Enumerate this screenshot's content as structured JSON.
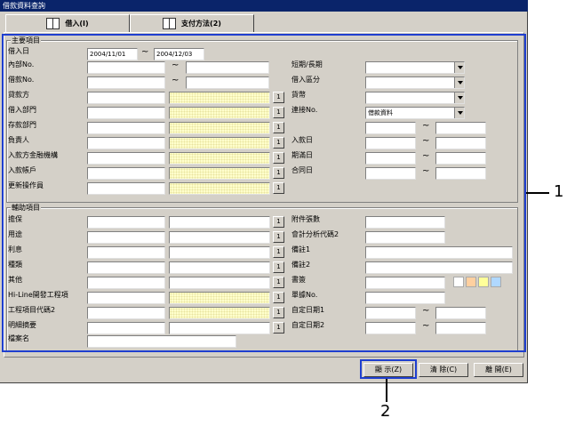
{
  "window": {
    "title": "借款資料查詢"
  },
  "tabs": [
    {
      "label": "借入(I)"
    },
    {
      "label": "支付方法(2)"
    }
  ],
  "main_group": {
    "legend": "主要項目",
    "borrow_date": {
      "label": "借入日",
      "from": "2004/11/01",
      "to": "2004/12/03"
    },
    "left_rows": [
      {
        "label": "內部No.",
        "value": ""
      },
      {
        "label": "借款No.",
        "value": ""
      },
      {
        "label": "貸款方",
        "value": ""
      },
      {
        "label": "借入部門",
        "value": ""
      },
      {
        "label": "存款部門",
        "value": ""
      },
      {
        "label": "負責人",
        "value": ""
      },
      {
        "label": "入款方金融機構",
        "value": ""
      },
      {
        "label": "入款帳戶",
        "value": ""
      },
      {
        "label": "更新操作員",
        "value": ""
      }
    ],
    "right_selects": [
      {
        "label": "短期/長期",
        "value": ""
      },
      {
        "label": "借入區分",
        "value": ""
      },
      {
        "label": "貨幣",
        "value": ""
      },
      {
        "label": "連接No.",
        "value": "借款資料"
      }
    ],
    "right_ranges": [
      {
        "label": "",
        "from": "",
        "to": ""
      },
      {
        "label": "入款日",
        "from": "",
        "to": ""
      },
      {
        "label": "期滿日",
        "from": "",
        "to": ""
      },
      {
        "label": "合同日",
        "from": "",
        "to": ""
      }
    ]
  },
  "aux_group": {
    "legend": "輔助項目",
    "left_rows": [
      {
        "label": "擔保",
        "value": ""
      },
      {
        "label": "用途",
        "value": ""
      },
      {
        "label": "利息",
        "value": ""
      },
      {
        "label": "種類",
        "value": ""
      },
      {
        "label": "其他",
        "value": ""
      },
      {
        "label": "Hi-Line開發工程項",
        "value": ""
      },
      {
        "label": "工程項目代碼2",
        "value": ""
      },
      {
        "label": "明細摘要",
        "value": ""
      }
    ],
    "file_name": {
      "label": "檔案名",
      "value": ""
    },
    "right_fields": [
      {
        "label": "附件張數",
        "value": ""
      },
      {
        "label": "會計分析代碼2",
        "value": ""
      },
      {
        "label": "備註1",
        "value": ""
      },
      {
        "label": "備註2",
        "value": ""
      },
      {
        "label": "書簽",
        "value": ""
      },
      {
        "label": "單據No.",
        "value": ""
      }
    ],
    "right_ranges": [
      {
        "label": "自定日期1",
        "from": "",
        "to": ""
      },
      {
        "label": "自定日期2",
        "from": "",
        "to": ""
      }
    ]
  },
  "range_sep": "~",
  "lookup_label": "1",
  "bookmark_colors": [
    "#ffffff",
    "#ffd0a0",
    "#ffff99",
    "#b0d8ff"
  ],
  "buttons": {
    "display": "顯 示(Z)",
    "clear": "清 除(C)",
    "close": "離 開(E)"
  },
  "callouts": {
    "one": "1",
    "two": "2"
  },
  "colors": {
    "callout": "#1f3fcf",
    "titlebar": "#0a246a",
    "highlight_input": "#ffffcc"
  }
}
